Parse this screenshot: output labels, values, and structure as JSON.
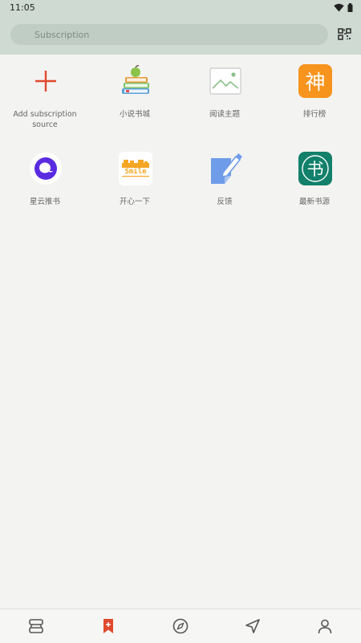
{
  "status_bar": {
    "time": "11:05"
  },
  "search": {
    "placeholder": "Subscription"
  },
  "sources": [
    {
      "label": "Add subscription source",
      "icon": "add-icon"
    },
    {
      "label": "小说书城",
      "icon": "books-apple-icon"
    },
    {
      "label": "阅读主题",
      "icon": "image-placeholder-icon"
    },
    {
      "label": "排行榜",
      "icon": "shen-icon",
      "glyph": "神"
    },
    {
      "label": "星云推书",
      "icon": "nebula-icon"
    },
    {
      "label": "开心一下",
      "icon": "smile-icon",
      "glyph": "Smile"
    },
    {
      "label": "反馈",
      "icon": "feedback-edit-icon"
    },
    {
      "label": "最新书源",
      "icon": "book-source-icon",
      "glyph": "书"
    }
  ],
  "bottom_nav": [
    {
      "icon": "bookshelf-icon",
      "active": false
    },
    {
      "icon": "subscription-bookmark-icon",
      "active": true
    },
    {
      "icon": "discover-compass-icon",
      "active": false
    },
    {
      "icon": "navigation-arrow-icon",
      "active": false
    },
    {
      "icon": "profile-icon",
      "active": false
    }
  ],
  "colors": {
    "accent": "#e0492d",
    "header_bg": "#cfdad3"
  }
}
